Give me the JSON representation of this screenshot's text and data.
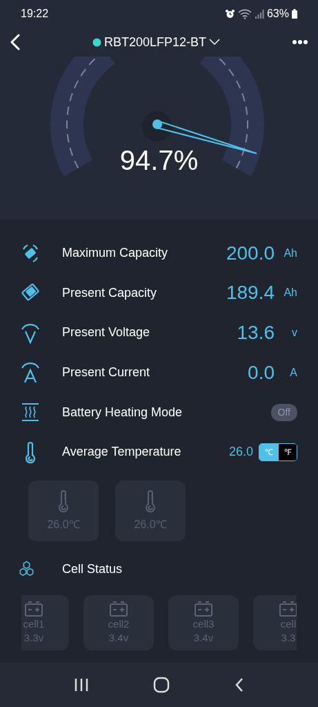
{
  "status_bar": {
    "time": "19:22",
    "battery": "63%"
  },
  "header": {
    "title": "RBT200LFP12-BT"
  },
  "gauge": {
    "reading": "94.7%"
  },
  "metrics": [
    {
      "kind": "value",
      "label": "Maximum Capacity",
      "value": "200.0",
      "unit": "Ah"
    },
    {
      "kind": "value",
      "label": "Present Capacity",
      "value": "189.4",
      "unit": "Ah"
    },
    {
      "kind": "value",
      "label": "Present Voltage",
      "value": "13.6",
      "unit": "v"
    },
    {
      "kind": "value",
      "label": "Present Current",
      "value": "0.0",
      "unit": "A"
    },
    {
      "kind": "toggle",
      "label": "Battery Heating Mode",
      "toggle_label": "Off",
      "on": false
    },
    {
      "kind": "temperature",
      "label": "Average Temperature",
      "value": "26.0",
      "units": [
        {
          "label": "℃",
          "selected": true
        },
        {
          "label": "℉",
          "selected": false
        }
      ]
    }
  ],
  "sensors": [
    {
      "reading": "26.0℃"
    },
    {
      "reading": "26.0℃"
    }
  ],
  "cell_status": {
    "title": "Cell Status",
    "cells": [
      {
        "name": "cell1",
        "voltage": "3.3v"
      },
      {
        "name": "cell2",
        "voltage": "3.4v"
      },
      {
        "name": "cell3",
        "voltage": "3.4v"
      },
      {
        "name": "cell",
        "voltage": "3.3"
      }
    ]
  }
}
